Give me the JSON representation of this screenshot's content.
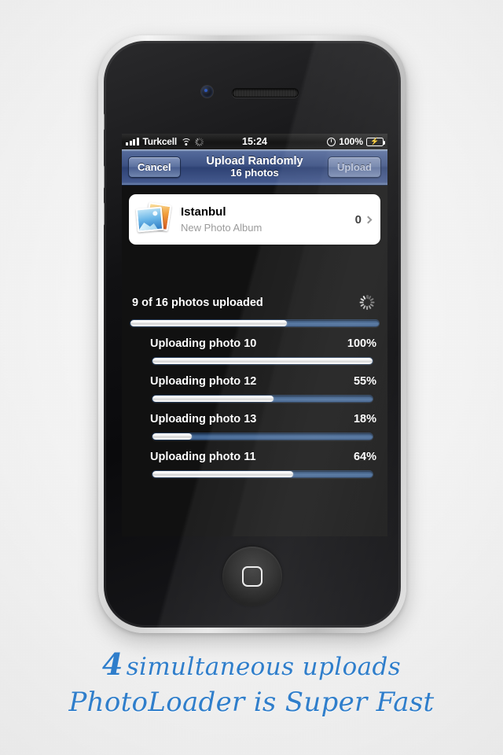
{
  "statusbar": {
    "carrier": "Turkcell",
    "time": "15:24",
    "battery_pct": "100%",
    "signal_icon": "signal-bars-icon",
    "wifi_icon": "wifi-icon",
    "activity_icon": "network-activity-spinner-icon",
    "alarm_icon": "alarm-clock-icon",
    "battery_icon": "battery-charging-icon"
  },
  "navbar": {
    "cancel_label": "Cancel",
    "upload_label": "Upload",
    "title": "Upload Randomly",
    "subtitle": "16 photos"
  },
  "album": {
    "title": "Istanbul",
    "subtitle": "New Photo Album",
    "count": "0",
    "thumb_icon": "photo-stack-icon",
    "chevron_icon": "chevron-right-icon"
  },
  "progress": {
    "summary": "9 of 16 photos uploaded",
    "spinner_icon": "activity-spinner-icon",
    "overall_percent": 63,
    "items": [
      {
        "label": "Uploading photo 10",
        "percent_label": "100%",
        "percent": 100
      },
      {
        "label": "Uploading photo 12",
        "percent_label": "55%",
        "percent": 55
      },
      {
        "label": "Uploading photo 13",
        "percent_label": "18%",
        "percent": 18
      },
      {
        "label": "Uploading photo 11",
        "percent_label": "64%",
        "percent": 64
      }
    ]
  },
  "caption": {
    "line1_number": "4",
    "line1_text": "simultaneous uploads",
    "line2": "PhotoLoader is Super Fast",
    "color": "#2f7ecb"
  },
  "device": {
    "camera_icon": "front-camera-icon",
    "speaker_icon": "earpiece-speaker-icon",
    "home_icon": "home-button-icon"
  }
}
